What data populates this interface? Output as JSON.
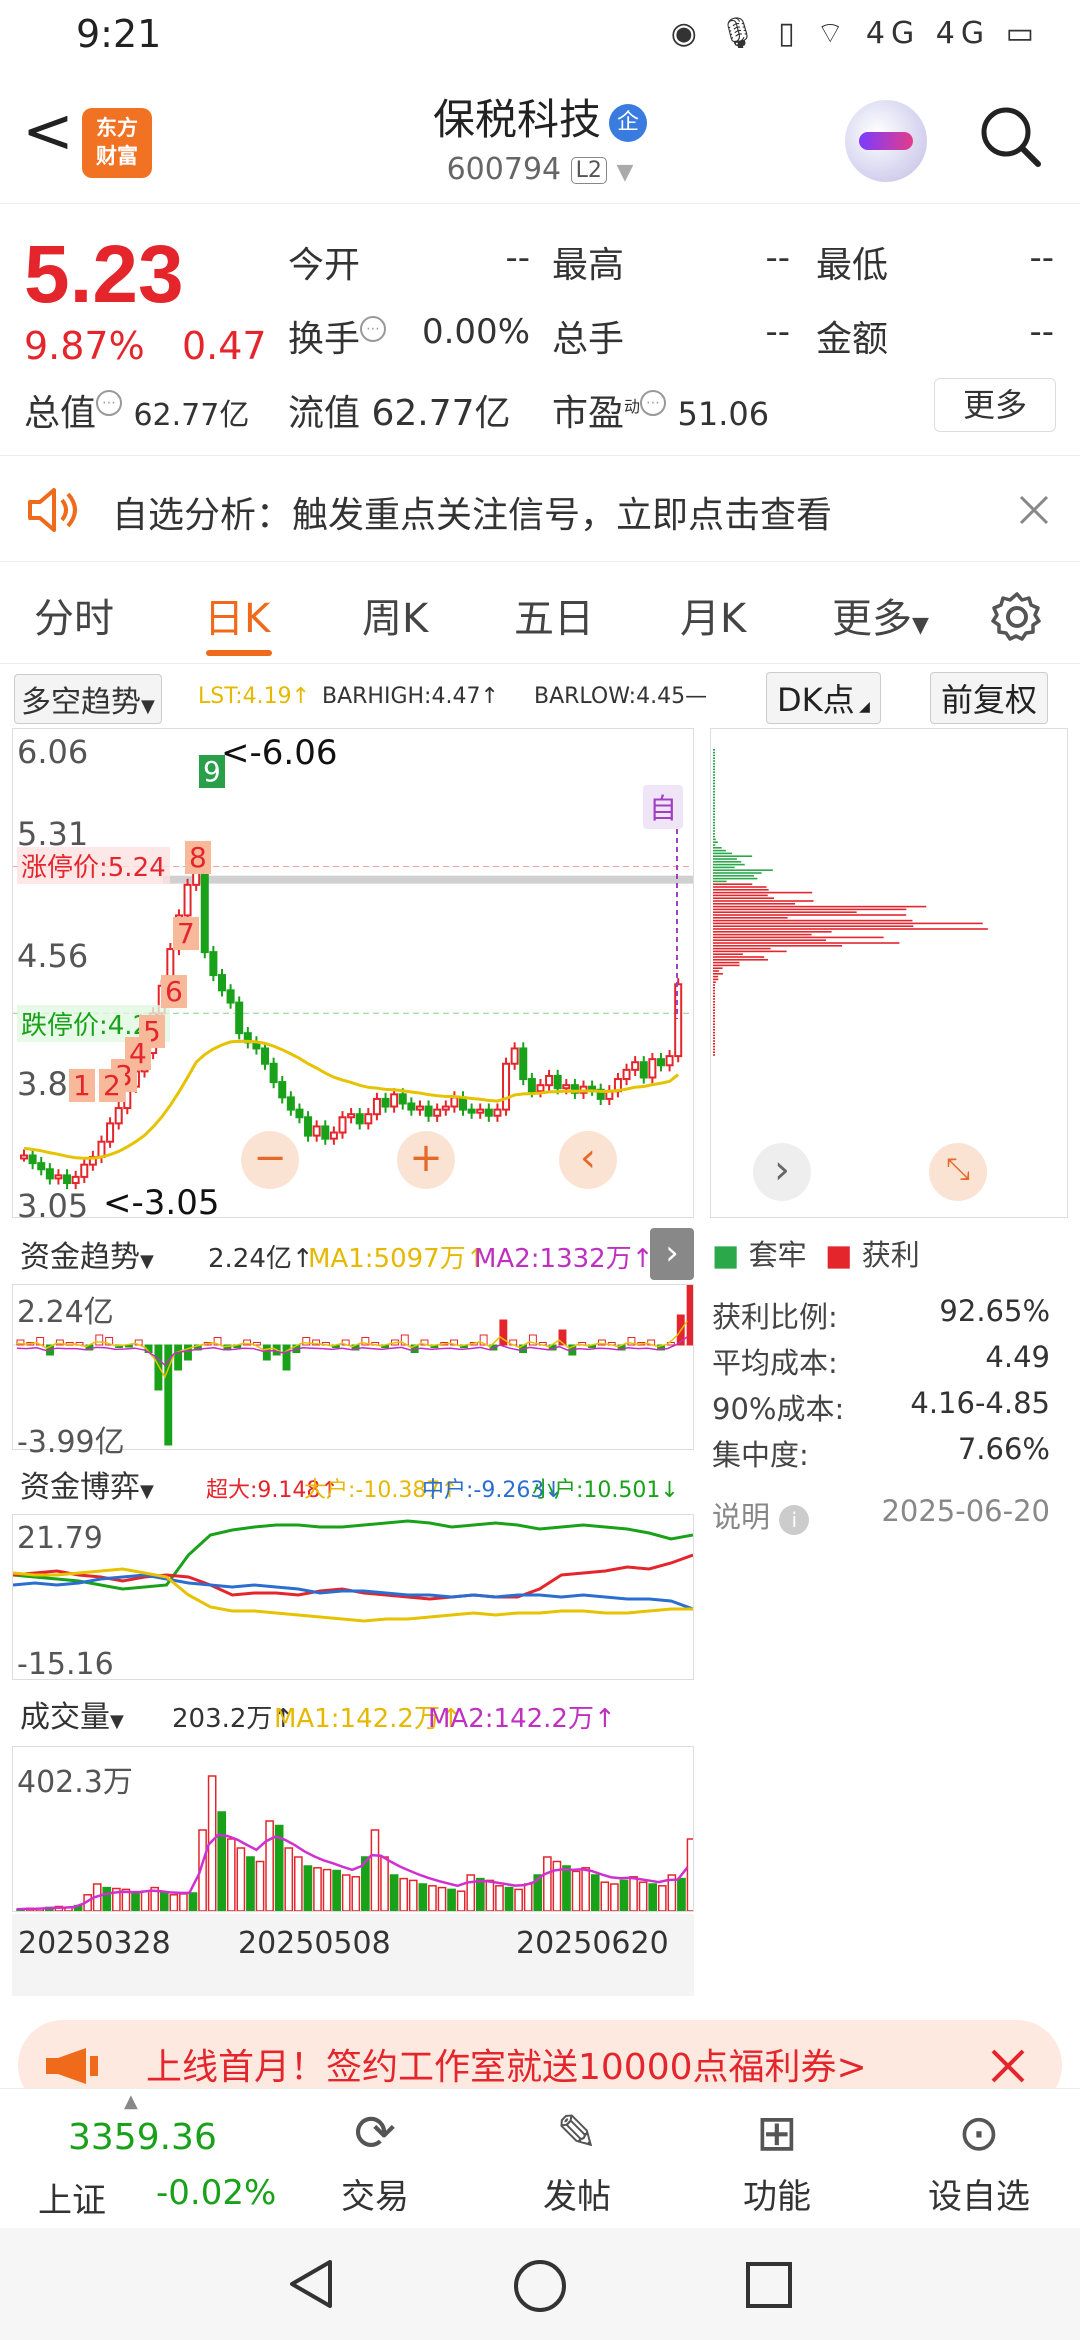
{
  "status": {
    "time": "9:21",
    "icons": "◉ 🎙 ▯ ⌔ 4G 4G ▭"
  },
  "header": {
    "back": "<",
    "logo_line1": "东方",
    "logo_line2": "财富",
    "name": "保税科技",
    "badge": "企",
    "code": "600794",
    "l2": "L2"
  },
  "quote": {
    "price": "5.23",
    "change_pct": "9.87%",
    "change_val": "0.47",
    "items": [
      {
        "label": "今开",
        "value": "--"
      },
      {
        "label": "最高",
        "value": "--"
      },
      {
        "label": "最低",
        "value": "--"
      },
      {
        "label": "换手",
        "value": "0.00%"
      },
      {
        "label": "总手",
        "value": "--"
      },
      {
        "label": "金额",
        "value": "--"
      }
    ],
    "mcap_label": "总值",
    "mcap": "62.77亿",
    "float_label": "流值",
    "float": "62.77亿",
    "pe_label": "市盈",
    "pe_sup": "动",
    "pe": "51.06",
    "more": "更多"
  },
  "notice": {
    "text": "自选分析：触发重点关注信号，立即点击查看"
  },
  "tabs": [
    "分时",
    "日K",
    "周K",
    "五日",
    "月K",
    "更多"
  ],
  "indicator": {
    "selector": "多空趋势",
    "lst": "LST:4.19↑",
    "barhigh": "BARHIGH:4.47↑",
    "barlow": "BARLOW:4.45—",
    "dk": "DK点",
    "fq": "前复权"
  },
  "kline": {
    "y_labels": [
      "6.06",
      "5.31",
      "4.56",
      "3.80",
      "3.05"
    ],
    "high_mark": "<-6.06",
    "low_mark": "<-3.05",
    "limit_up": "涨停价:5.24",
    "limit_down": "跌停价:4.28",
    "self_mark": "自",
    "signals": [
      "9",
      "8",
      "7",
      "6",
      "5",
      "4",
      "3",
      "2",
      "1"
    ]
  },
  "fund_trend": {
    "selector": "资金趋势",
    "v": "2.24亿↑",
    "ma1": "MA1:5097万↑",
    "ma2": "MA2:1332万↑",
    "top": "2.24亿",
    "bottom": "-3.99亿"
  },
  "fund_game": {
    "selector": "资金博弈",
    "s1": "超大:9.148↑",
    "s2": "大户:-10.387↑",
    "s3": "中户:-9.263↓",
    "s4": "小户:10.501↓",
    "top": "21.79",
    "bottom": "-15.16"
  },
  "volume": {
    "selector": "成交量",
    "v": "203.2万↑",
    "ma1": "MA1:142.2万↑",
    "ma2": "MA2:142.2万↑",
    "top": "402.3万"
  },
  "dates": [
    "20250328",
    "20250508",
    "20250620"
  ],
  "dist": {
    "legend_trap": "套牢",
    "legend_profit": "获利",
    "stats": [
      {
        "label": "获利比例:",
        "value": "92.65%"
      },
      {
        "label": "平均成本:",
        "value": "4.49"
      },
      {
        "label": "90%成本:",
        "value": "4.16-4.85"
      },
      {
        "label": "集中度:",
        "value": "7.66%"
      }
    ],
    "note": "说明",
    "date": "2025-06-20"
  },
  "ad": {
    "text": "上线首月！签约工作室就送10000点福利券>"
  },
  "nav": {
    "index_val": "3359.36",
    "index_name": "上证",
    "index_chg": "-0.02%",
    "items": [
      {
        "label": "交易"
      },
      {
        "label": "发帖"
      },
      {
        "label": "功能"
      },
      {
        "label": "设自选"
      }
    ]
  },
  "colors": {
    "up": "#e5252c",
    "down": "#1aa11a",
    "accent": "#f06a1c"
  }
}
